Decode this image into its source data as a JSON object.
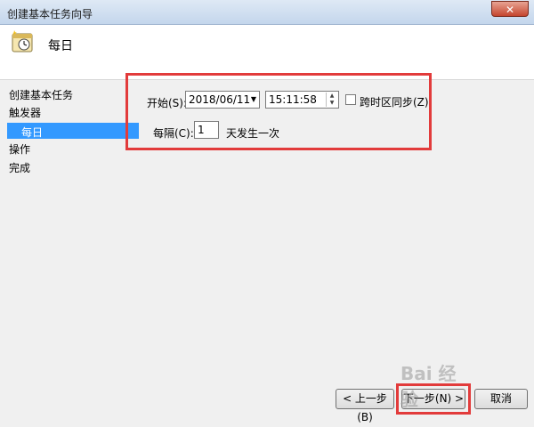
{
  "window": {
    "title": "创建基本任务向导",
    "close_glyph": "✕"
  },
  "header": {
    "title": "每日",
    "icon": "calendar-clock-icon"
  },
  "steps": [
    {
      "label": "创建基本任务",
      "active": false
    },
    {
      "label": "触发器",
      "active": false
    },
    {
      "label": "每日",
      "active": true
    },
    {
      "label": "操作",
      "active": false
    },
    {
      "label": "完成",
      "active": false
    }
  ],
  "form": {
    "start_label": "开始(S):",
    "start_date": "2018/06/11",
    "start_time": "15:11:58",
    "sync_timezone_label": "跨时区同步(Z)",
    "sync_timezone_checked": false,
    "recur_label": "每隔(C):",
    "recur_value": "1",
    "recur_suffix": "天发生一次"
  },
  "buttons": {
    "back": "< 上一步(B)",
    "next": "下一步(N) >",
    "cancel": "取消"
  },
  "watermark": "Bai 经验",
  "colors": {
    "selection": "#3399ff",
    "highlight": "#e23b3b"
  }
}
